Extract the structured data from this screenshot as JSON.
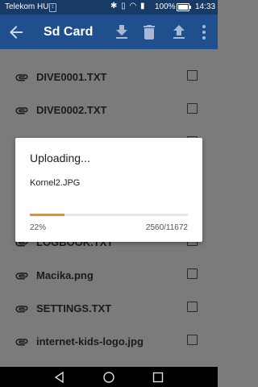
{
  "status": {
    "carrier": "Telekom HU",
    "battery": "100%",
    "time": "14:33"
  },
  "appbar": {
    "title": "Sd Card"
  },
  "files": [
    {
      "name": "DIVE0001.TXT"
    },
    {
      "name": "DIVE0002.TXT"
    },
    {
      "name": ""
    },
    {
      "name": ""
    },
    {
      "name": ""
    },
    {
      "name": "LOGBOOK.TXT"
    },
    {
      "name": "Macika.png"
    },
    {
      "name": "SETTINGS.TXT"
    },
    {
      "name": "internet-kids-logo.jpg"
    }
  ],
  "dialog": {
    "title": "Uploading...",
    "file": "Kornel2.JPG",
    "progress_percent": 22,
    "progress_label": "22%",
    "count": "2560/11672"
  },
  "colors": {
    "appbar": "#1f4f8d",
    "statusbar": "#173a66",
    "progress": "#f08a24"
  }
}
